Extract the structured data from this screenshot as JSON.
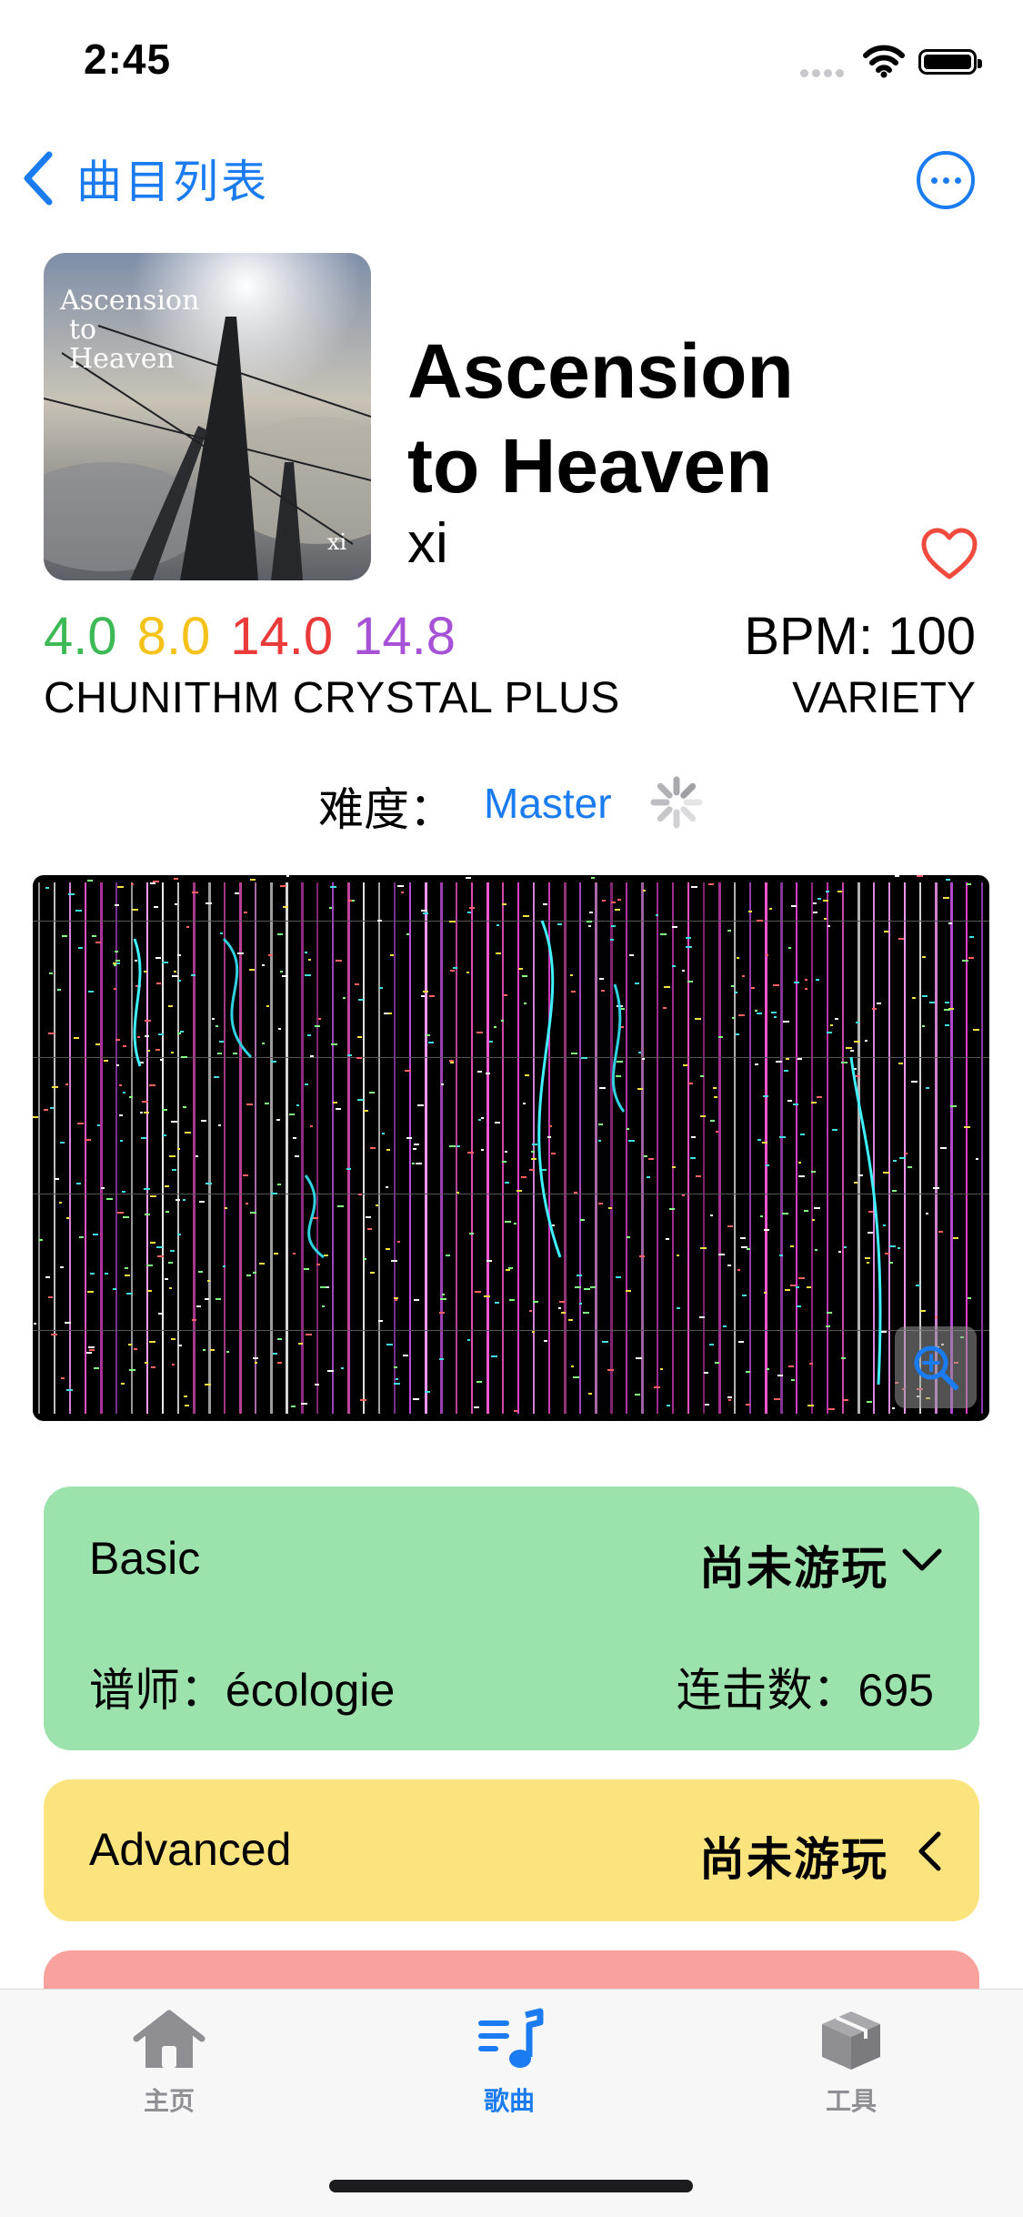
{
  "status_bar": {
    "time": "2:45"
  },
  "nav": {
    "back_label": "曲目列表",
    "more_icon": "ellipsis-circle-icon"
  },
  "song": {
    "title_line1": "Ascension",
    "title_line2": "to Heaven",
    "artist": "xi",
    "cover_text_line1": "Ascension",
    "cover_text_line2": "to",
    "cover_text_line3": "Heaven",
    "cover_text_corner": "xi",
    "levels": [
      {
        "value": "4.0",
        "color": "#3dba55"
      },
      {
        "value": "8.0",
        "color": "#f5c219"
      },
      {
        "value": "14.0",
        "color": "#eb3a3a"
      },
      {
        "value": "14.8",
        "color": "#a752d6"
      }
    ],
    "version": "CHUNITHM CRYSTAL PLUS",
    "bpm": "BPM: 100",
    "genre": "VARIETY"
  },
  "difficulty_picker": {
    "label": "难度：",
    "value": "Master"
  },
  "cards": {
    "basic": {
      "name": "Basic",
      "status": "尚未游玩",
      "charter": "谱师：écologie",
      "combo": "连击数：695",
      "color": "#9ce2ad"
    },
    "advanced": {
      "name": "Advanced",
      "status": "尚未游玩",
      "color": "#fbe37e"
    },
    "expert": {
      "color": "#f9a19c"
    }
  },
  "tabs": [
    {
      "label": "主页",
      "icon": "house-icon",
      "active": false
    },
    {
      "label": "歌曲",
      "icon": "music-list-icon",
      "active": true
    },
    {
      "label": "工具",
      "icon": "cube-icon",
      "active": false
    }
  ],
  "accent_color": "#1a7cf0"
}
